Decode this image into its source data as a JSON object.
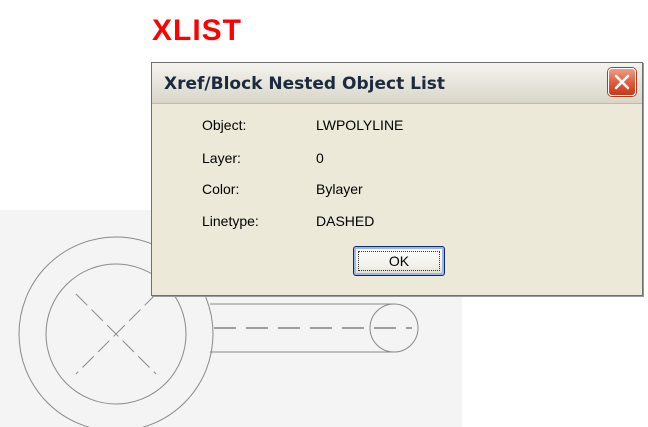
{
  "command": {
    "label": "XLIST",
    "color": "#ff0000"
  },
  "dialog": {
    "title": "Xref/Block Nested Object List",
    "close_icon": "close-icon",
    "properties": [
      {
        "label": "Object:",
        "value": "LWPOLYLINE"
      },
      {
        "label": "Layer:",
        "value": "0"
      },
      {
        "label": "Color:",
        "value": "Bylayer"
      },
      {
        "label": "Linetype:",
        "value": "DASHED"
      }
    ],
    "ok_label": "OK"
  },
  "drawing": {
    "background": "#f4f4f4",
    "line_color": "#8a8a8a"
  }
}
